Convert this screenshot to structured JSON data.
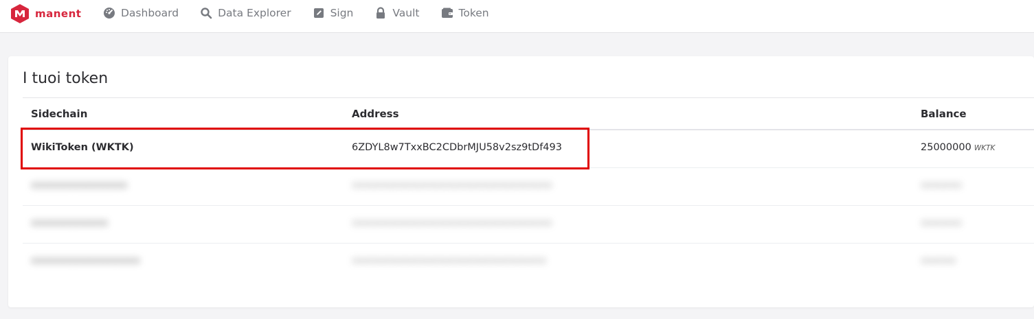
{
  "brand": {
    "name": "manent",
    "color": "#d7263d"
  },
  "nav": {
    "items": [
      {
        "label": "Dashboard",
        "icon": "dashboard-gauge-icon"
      },
      {
        "label": "Data Explorer",
        "icon": "search-icon"
      },
      {
        "label": "Sign",
        "icon": "edit-icon"
      },
      {
        "label": "Vault",
        "icon": "lock-icon"
      },
      {
        "label": "Token",
        "icon": "wallet-icon"
      }
    ]
  },
  "card": {
    "title": "I tuoi token",
    "columns": {
      "sidechain": "Sidechain",
      "address": "Address",
      "balance": "Balance"
    },
    "rows": [
      {
        "sidechain": "WikiToken (WKTK)",
        "address": "6ZDYL8w7TxxBC2CDbrMJU58v2sz9tDf493",
        "balance": "25000000",
        "unit": "WKTK"
      },
      {
        "sidechain": "xxxxxxxxxxxxxxx",
        "address": "xxxxxxxxxxxxxxxxxxxxxxxxxxxxxxxxxx",
        "balance": "xxxxxxx"
      },
      {
        "sidechain": "xxxxxxxxxxxx",
        "address": "xxxxxxxxxxxxxxxxxxxxxxxxxxxxxxxxxx",
        "balance": "xxxxxxx"
      },
      {
        "sidechain": "xxxxxxxxxxxxxxxxx",
        "address": "xxxxxxxxxxxxxxxxxxxxxxxxxxxxxxxxx",
        "balance": "xxxxxx"
      }
    ]
  },
  "colors": {
    "highlight": "#e00000",
    "background": "#f4f4f6"
  }
}
